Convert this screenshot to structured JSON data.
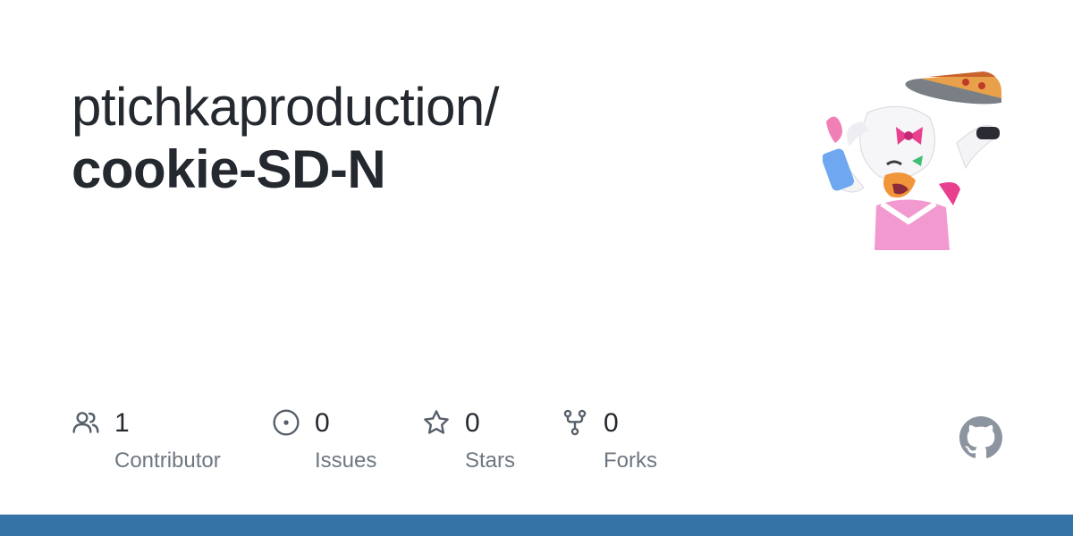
{
  "repo": {
    "owner": "ptichkaproduction/",
    "name": "cookie-SD-N"
  },
  "stats": [
    {
      "icon": "people-icon",
      "count": "1",
      "label": "Contributor"
    },
    {
      "icon": "issue-opened-icon",
      "count": "0",
      "label": "Issues"
    },
    {
      "icon": "star-icon",
      "count": "0",
      "label": "Stars"
    },
    {
      "icon": "repo-forked-icon",
      "count": "0",
      "label": "Forks"
    }
  ],
  "colors": {
    "title": "#24292f",
    "label": "#6e7781",
    "icon": "#57606a",
    "bottom_bar": "#3572a5",
    "github_mark": "#8c959f"
  },
  "avatar": {
    "icon": "avatar-image"
  },
  "brand": {
    "icon": "github-mark-icon"
  }
}
